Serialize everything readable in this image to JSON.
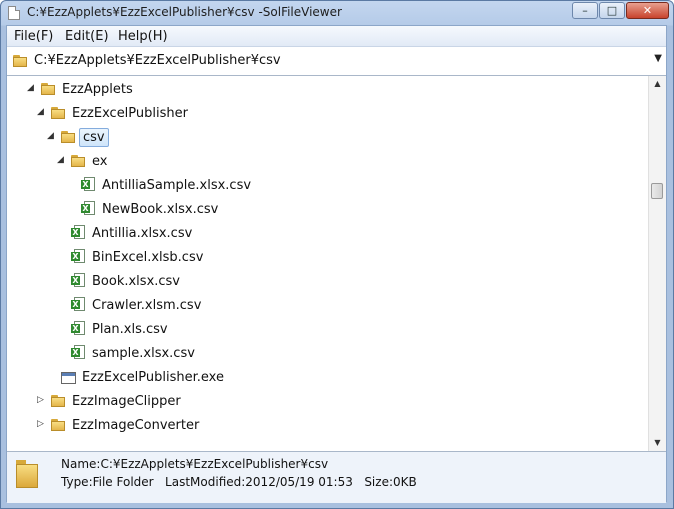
{
  "window": {
    "title": "C:¥EzzApplets¥EzzExcelPublisher¥csv -SolFileViewer",
    "minimize": "–",
    "maximize": "□",
    "close": "✕"
  },
  "menu": {
    "file": "File(F)",
    "edit": "Edit(E)",
    "help": "Help(H)"
  },
  "path": {
    "value": "C:¥EzzApplets¥EzzExcelPublisher¥csv",
    "dropdown_icon": "▼"
  },
  "tree": [
    {
      "label": "EzzApplets",
      "type": "folder",
      "expanded": true
    },
    {
      "label": "EzzExcelPublisher",
      "type": "folder",
      "expanded": true
    },
    {
      "label": "csv",
      "type": "folder",
      "expanded": true,
      "selected": true
    },
    {
      "label": "ex",
      "type": "folder",
      "expanded": true
    },
    {
      "label": "AntilliaSample.xlsx.csv",
      "type": "csv"
    },
    {
      "label": "NewBook.xlsx.csv",
      "type": "csv"
    },
    {
      "label": "Antillia.xlsx.csv",
      "type": "csv"
    },
    {
      "label": "BinExcel.xlsb.csv",
      "type": "csv"
    },
    {
      "label": "Book.xlsx.csv",
      "type": "csv"
    },
    {
      "label": "Crawler.xlsm.csv",
      "type": "csv"
    },
    {
      "label": "Plan.xls.csv",
      "type": "csv"
    },
    {
      "label": "sample.xlsx.csv",
      "type": "csv"
    },
    {
      "label": "EzzExcelPublisher.exe",
      "type": "exe"
    },
    {
      "label": "EzzImageClipper",
      "type": "folder",
      "expanded": false
    },
    {
      "label": "EzzImageConverter",
      "type": "folder",
      "expanded": false
    }
  ],
  "status": {
    "name_line": "Name:C:¥EzzApplets¥EzzExcelPublisher¥csv",
    "type": "Type:File Folder",
    "modified": "LastModified:2012/05/19 01:53",
    "size": "Size:0KB"
  },
  "icons": {
    "folder": "folder-icon",
    "csv": "excel-csv-icon",
    "exe": "exe-icon"
  }
}
